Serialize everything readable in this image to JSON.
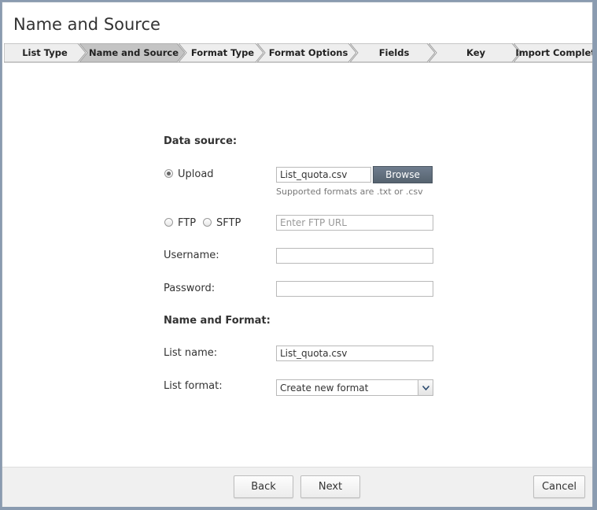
{
  "window": {
    "title": "Name and Source"
  },
  "steps": [
    {
      "label": "List Type",
      "active": false
    },
    {
      "label": "Name and Source",
      "active": true
    },
    {
      "label": "Format Type",
      "active": false
    },
    {
      "label": "Format Options",
      "active": false
    },
    {
      "label": "Fields",
      "active": false
    },
    {
      "label": "Key",
      "active": false
    },
    {
      "label": "Import Complete",
      "active": false
    }
  ],
  "data_source": {
    "heading": "Data source:",
    "upload_label": "Upload",
    "upload_selected": true,
    "file_value": "List_quota.csv",
    "browse_label": "Browse",
    "hint": "Supported formats are .txt or .csv",
    "ftp_label": "FTP",
    "sftp_label": "SFTP",
    "ftp_url_placeholder": "Enter FTP URL",
    "ftp_url_value": "",
    "username_label": "Username:",
    "username_value": "",
    "password_label": "Password:",
    "password_value": ""
  },
  "name_format": {
    "heading": "Name and Format:",
    "list_name_label": "List name:",
    "list_name_value": "List_quota.csv",
    "list_format_label": "List format:",
    "list_format_value": "Create new format"
  },
  "footer": {
    "back_label": "Back",
    "next_label": "Next",
    "cancel_label": "Cancel"
  },
  "colors": {
    "step_active": "#c4c4c4",
    "step_inactive": "#eeeeee",
    "browse_button": "#646f7b"
  }
}
